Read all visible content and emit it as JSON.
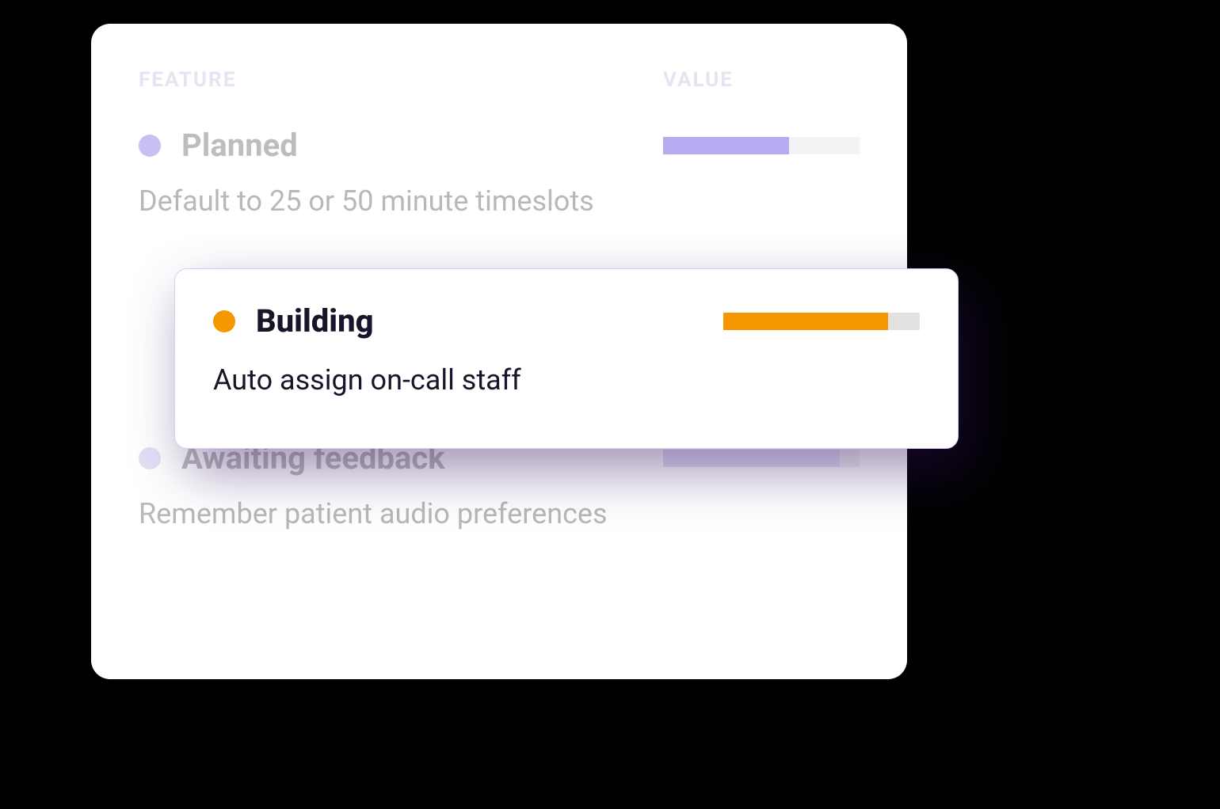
{
  "headers": {
    "feature": "FEATURE",
    "value": "VALUE"
  },
  "rows": [
    {
      "status": "Planned",
      "description": "Default to 25 or 50 minute timeslots",
      "dot_color": "#C7C1F3",
      "progress_pct": 64,
      "progress_color": "#B7ABF1"
    },
    {
      "status": "Building",
      "description": "Auto assign on-call staff",
      "dot_color": "#F59800",
      "progress_pct": 84,
      "progress_color": "#F59800",
      "highlighted": true
    },
    {
      "status": "Awaiting feedback",
      "description": "Remember patient audio preferences",
      "dot_color": "#E4E0F6",
      "progress_pct": 90,
      "progress_color": "#E6E0F6"
    }
  ]
}
